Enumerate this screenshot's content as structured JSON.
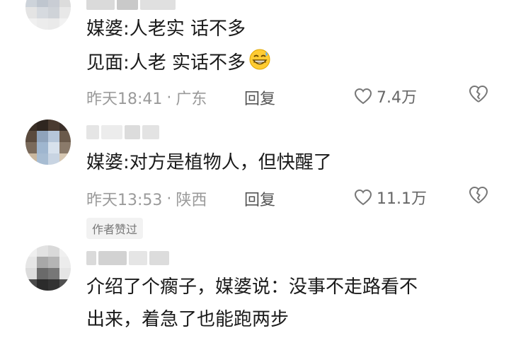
{
  "comments": [
    {
      "lines": [
        "媒婆:人老实  话不多",
        "见面:人老   实话不多"
      ],
      "emoji": "grinning-sweat-emoji",
      "time": "昨天18:41",
      "location": "广东",
      "reply_label": "回复",
      "likes": "7.4万"
    },
    {
      "lines": [
        "媒婆:对方是植物人，但快醒了"
      ],
      "time": "昨天13:53",
      "location": "陕西",
      "reply_label": "回复",
      "likes": "11.1万",
      "badge": "作者赞过"
    },
    {
      "lines": [
        "介绍了个瘸子，媒婆说：没事不走路看不",
        "出来，着急了也能跑两步"
      ]
    }
  ],
  "separator": "·",
  "colors": {
    "meta": "#9a9a9a",
    "text": "#1a1a1a",
    "badge_bg": "#f2f2f2"
  }
}
